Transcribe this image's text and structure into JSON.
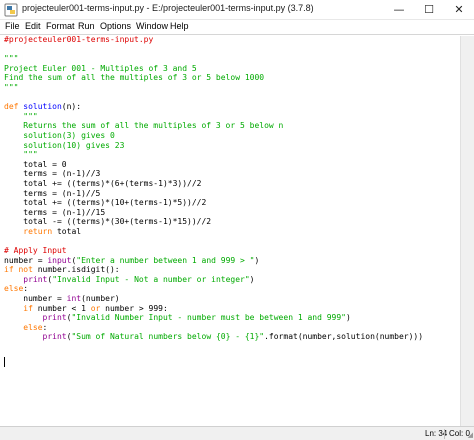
{
  "window": {
    "title": "projecteuler001-terms-input.py - E:/projecteuler001-terms-input.py (3.7.8)",
    "minimize_glyph": "—",
    "maximize_glyph": "☐",
    "close_glyph": "✕"
  },
  "menu": [
    "File",
    "Edit",
    "Format",
    "Run",
    "Options",
    "Window",
    "Help"
  ],
  "status": {
    "line": "Ln: 34",
    "col": "Col: 0"
  },
  "icons": {
    "app": "idle-python-icon",
    "grip": "resize-grip-icon"
  },
  "code_lines": [
    [
      [
        "cm",
        "#projecteuler001-terms-input.py"
      ]
    ],
    [],
    [
      [
        "st",
        "\"\"\""
      ]
    ],
    [
      [
        "st",
        "Project Euler 001 - Multiples of 3 and 5"
      ]
    ],
    [
      [
        "st",
        "Find the sum of all the multiples of 3 or 5 below 1000"
      ]
    ],
    [
      [
        "st",
        "\"\"\""
      ]
    ],
    [],
    [
      [
        "kw",
        "def "
      ],
      [
        "df",
        "solution"
      ],
      [
        "",
        "(n):"
      ]
    ],
    [
      [
        "st",
        "    \"\"\""
      ]
    ],
    [
      [
        "st",
        "    Returns the sum of all the multiples of 3 or 5 below n"
      ]
    ],
    [
      [
        "st",
        "    solution(3) gives 0"
      ]
    ],
    [
      [
        "st",
        "    solution(10) gives 23"
      ]
    ],
    [
      [
        "st",
        "    \"\"\""
      ]
    ],
    [
      [
        "",
        "    total = 0"
      ]
    ],
    [
      [
        "",
        "    terms = (n-1)//3"
      ]
    ],
    [
      [
        "",
        "    total += ((terms)*(6+(terms-1)*3))//2"
      ]
    ],
    [
      [
        "",
        "    terms = (n-1)//5"
      ]
    ],
    [
      [
        "",
        "    total += ((terms)*(10+(terms-1)*5))//2"
      ]
    ],
    [
      [
        "",
        "    terms = (n-1)//15"
      ]
    ],
    [
      [
        "",
        "    total -= ((terms)*(30+(terms-1)*15))//2"
      ]
    ],
    [
      [
        "kw",
        "    return"
      ],
      [
        "",
        " total"
      ]
    ],
    [],
    [
      [
        "cm",
        "# Apply Input"
      ]
    ],
    [
      [
        "",
        "number = "
      ],
      [
        "bi",
        "input"
      ],
      [
        "",
        "("
      ],
      [
        "st",
        "\"Enter a number between 1 and 999 > \""
      ],
      [
        "",
        ")"
      ]
    ],
    [
      [
        "kw",
        "if not"
      ],
      [
        "",
        " number.isdigit():"
      ]
    ],
    [
      [
        "",
        "    "
      ],
      [
        "bi",
        "print"
      ],
      [
        "",
        "("
      ],
      [
        "st",
        "\"Invalid Input - Not a number or integer\""
      ],
      [
        "",
        ")"
      ]
    ],
    [
      [
        "kw",
        "else"
      ],
      [
        "",
        ":"
      ]
    ],
    [
      [
        "",
        "    number = "
      ],
      [
        "bi",
        "int"
      ],
      [
        "",
        "(number)"
      ]
    ],
    [
      [
        "kw",
        "    if"
      ],
      [
        "",
        " number < 1 "
      ],
      [
        "kw",
        "or"
      ],
      [
        "",
        " number > 999:"
      ]
    ],
    [
      [
        "",
        "        "
      ],
      [
        "bi",
        "print"
      ],
      [
        "",
        "("
      ],
      [
        "st",
        "\"Invalid Number Input - number must be between 1 and 999\""
      ],
      [
        "",
        ")"
      ]
    ],
    [
      [
        "kw",
        "    else"
      ],
      [
        "",
        ":"
      ]
    ],
    [
      [
        "",
        "        "
      ],
      [
        "bi",
        "print"
      ],
      [
        "",
        "("
      ],
      [
        "st",
        "\"Sum of Natural numbers below {0} - {1}\""
      ],
      [
        "",
        ".format(number,solution(number)))"
      ]
    ]
  ]
}
